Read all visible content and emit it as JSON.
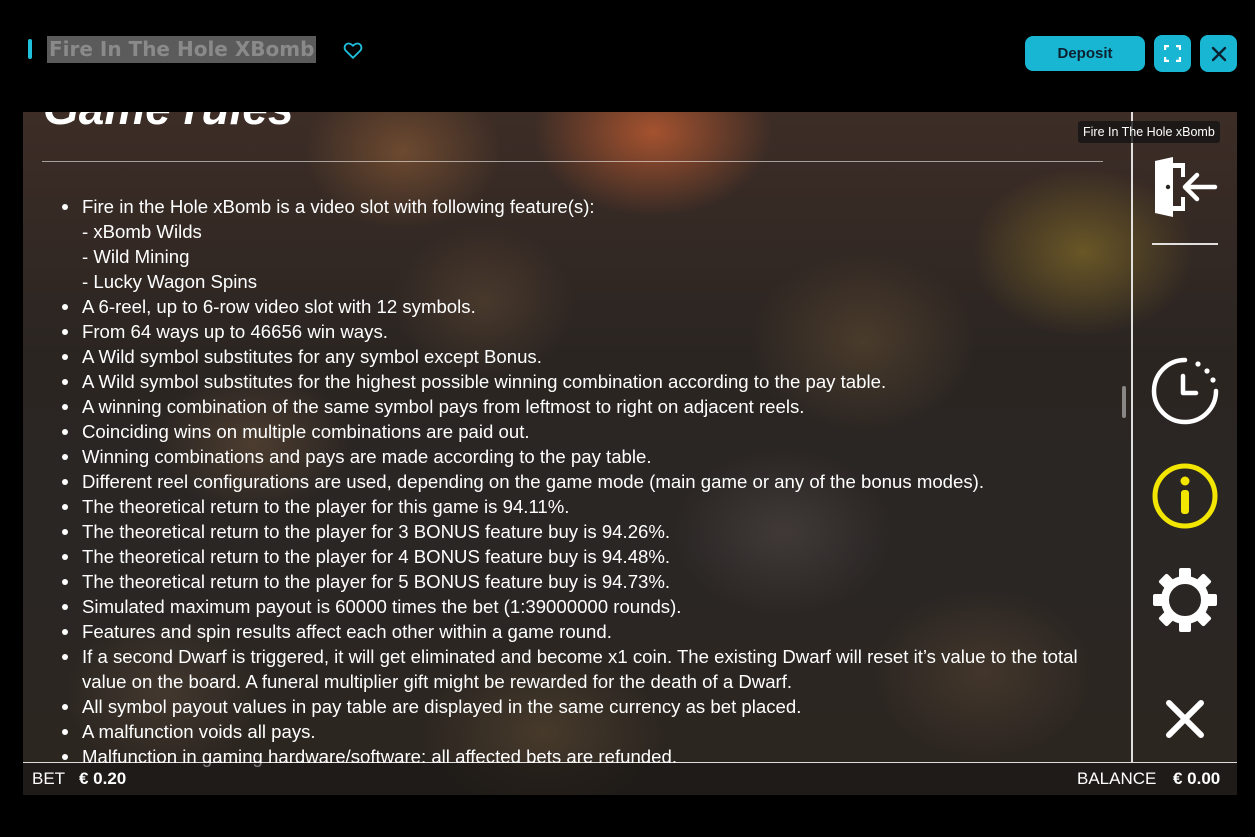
{
  "topbar": {
    "title": "Fire In The Hole XBomb",
    "deposit_label": "Deposit",
    "accent_color": "#18b6d2",
    "icons": [
      "heart-icon",
      "fullscreen-icon",
      "close-icon"
    ]
  },
  "rules": {
    "heading": "Game rules",
    "items": [
      {
        "text": "Fire in the Hole xBomb is a video slot with following feature(s):",
        "sub": [
          "- xBomb Wilds",
          "- Wild Mining",
          "- Lucky Wagon Spins"
        ]
      },
      {
        "text": "A 6-reel, up to 6-row video slot with 12 symbols."
      },
      {
        "text": "From 64 ways up to 46656 win ways."
      },
      {
        "text": "A Wild symbol substitutes for any symbol except Bonus."
      },
      {
        "text": "A Wild symbol substitutes for the highest possible winning combination according to the pay table."
      },
      {
        "text": "A winning combination of the same symbol pays from leftmost to right on adjacent reels."
      },
      {
        "text": "Coinciding wins on multiple combinations are paid out."
      },
      {
        "text": "Winning combinations and pays are made according to the pay table."
      },
      {
        "text": "Different reel configurations are used, depending on the game mode (main game or any of the bonus modes)."
      },
      {
        "text": "The theoretical return to the player for this game is 94.11%."
      },
      {
        "text": "The theoretical return to the player for 3 BONUS feature buy is 94.26%."
      },
      {
        "text": "The theoretical return to the player for 4 BONUS feature buy is 94.48%."
      },
      {
        "text": "The theoretical return to the player for 5 BONUS feature buy is 94.73%."
      },
      {
        "text": "Simulated maximum payout is 60000 times the bet (1:39000000 rounds)."
      },
      {
        "text": "Features and spin results affect each other within a game round."
      },
      {
        "text": "If a second Dwarf is triggered, it will get eliminated and become x1 coin. The existing Dwarf will reset it’s value to the total value on the board. A funeral multiplier gift might be rewarded for the death of a Dwarf."
      },
      {
        "text": "All symbol payout values in pay table are displayed in the same currency as bet placed."
      },
      {
        "text": "A malfunction voids all pays."
      },
      {
        "text": "Malfunction in gaming hardware/software: all affected bets are refunded."
      }
    ]
  },
  "side": {
    "tooltip": "Fire In The Hole xBomb",
    "icons": [
      "exit-icon",
      "history-icon",
      "info-icon",
      "settings-icon",
      "close-icon"
    ],
    "info_color": "#f2e600"
  },
  "bottom": {
    "bet_label": "BET",
    "bet_value": "€ 0.20",
    "balance_label": "BALANCE",
    "balance_value": "€ 0.00"
  }
}
